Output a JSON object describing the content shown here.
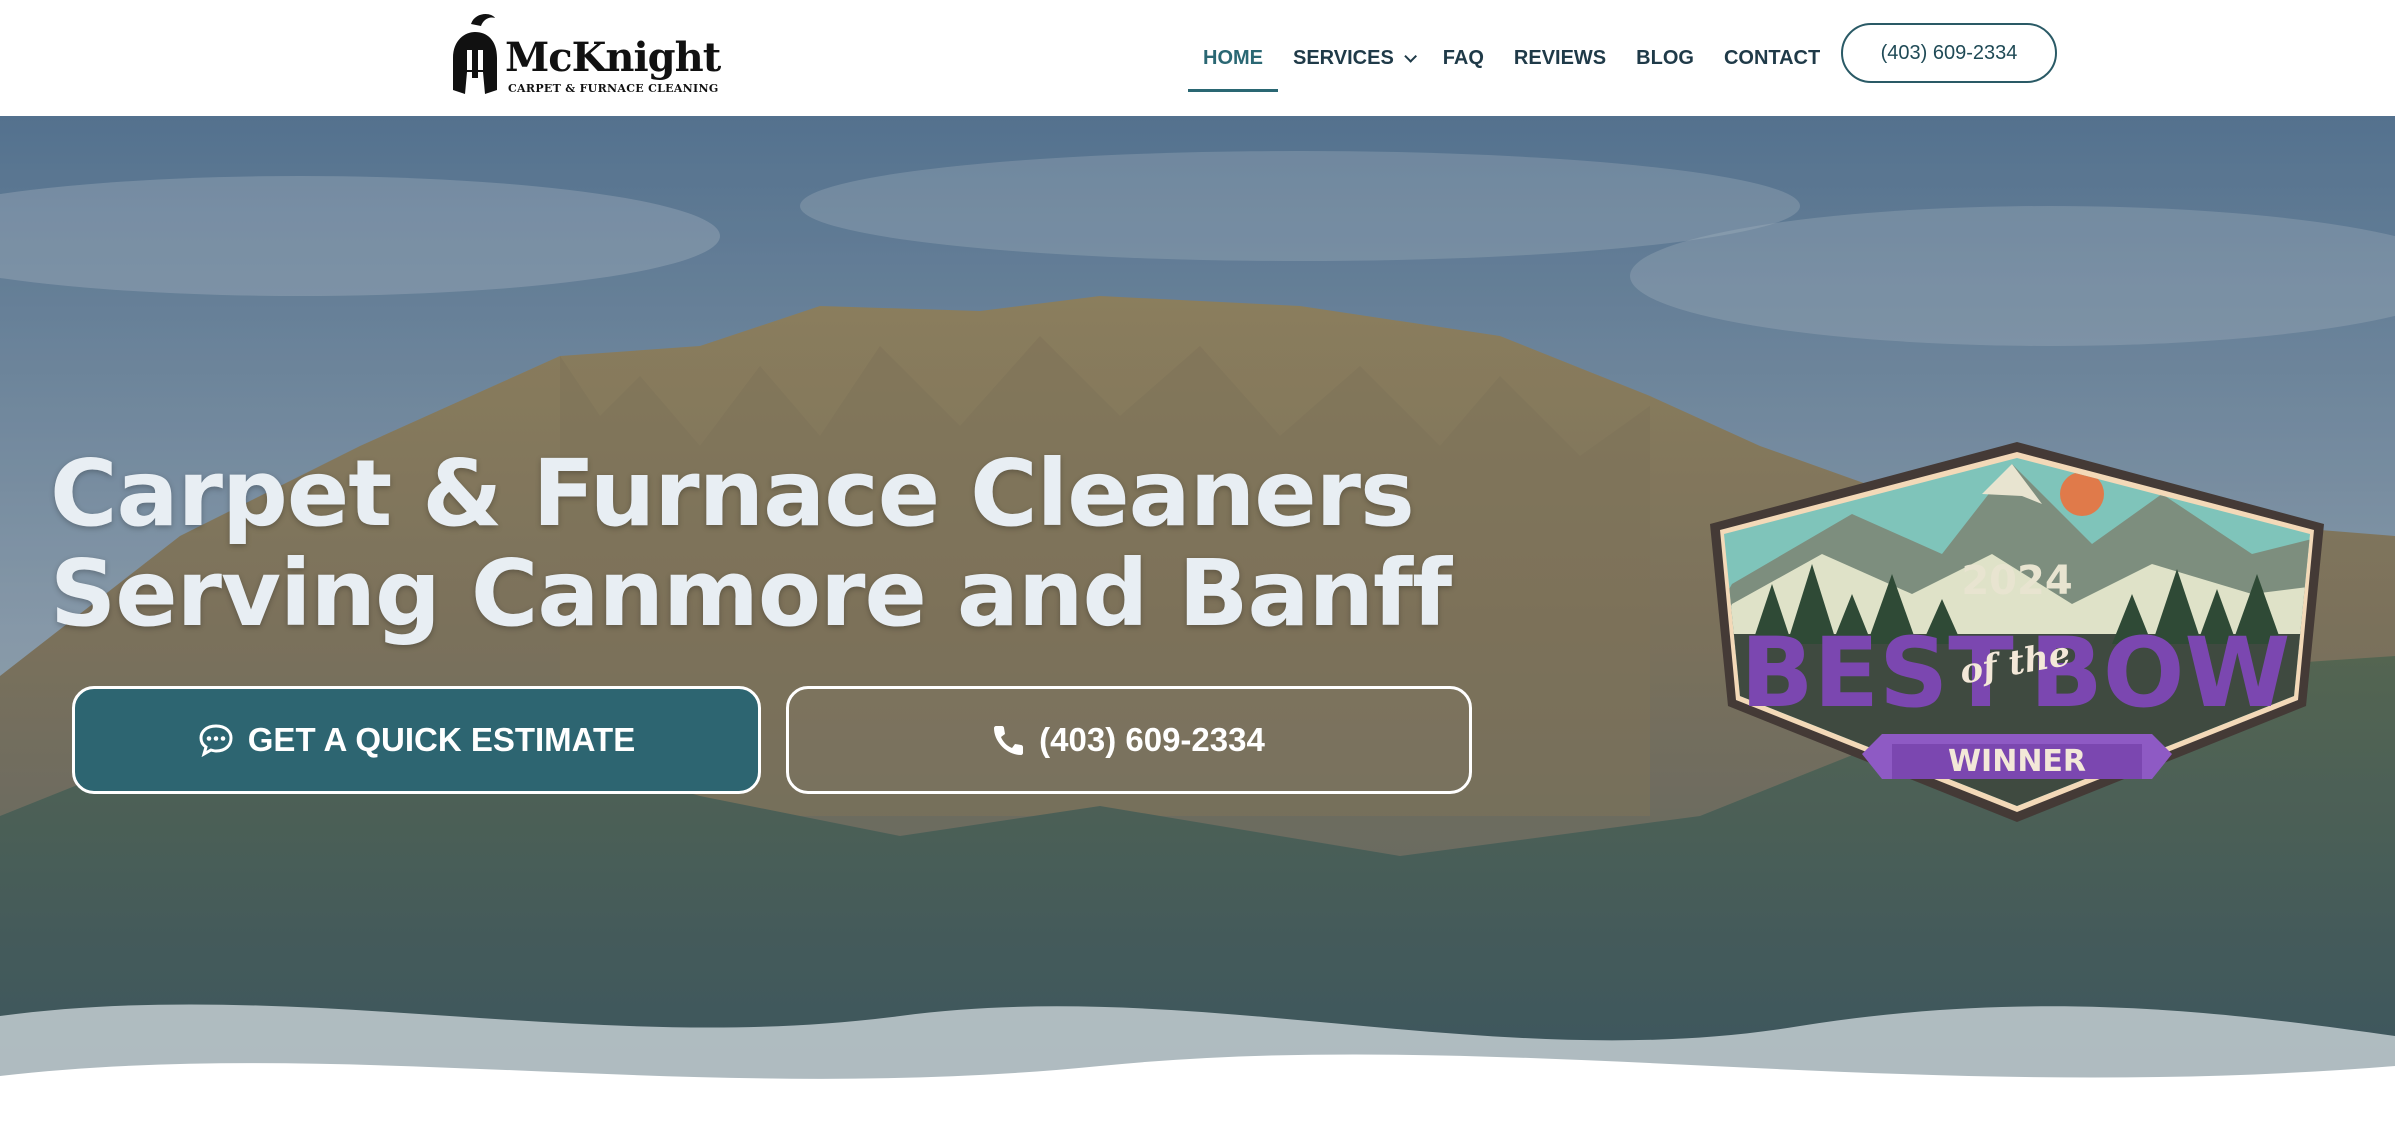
{
  "logo": {
    "title": "McKnight",
    "subtitle": "CARPET & FURNACE CLEANING"
  },
  "nav": {
    "items": [
      {
        "label": "HOME",
        "active": true
      },
      {
        "label": "SERVICES",
        "has_dropdown": true
      },
      {
        "label": "FAQ"
      },
      {
        "label": "REVIEWS"
      },
      {
        "label": "BLOG"
      },
      {
        "label": "CONTACT"
      }
    ],
    "phone_button": "(403) 609-2334"
  },
  "hero": {
    "headline_line1": "Carpet & Furnace Cleaners",
    "headline_line2": "Serving Canmore and Banff",
    "cta_estimate": "GET A QUICK ESTIMATE",
    "cta_phone": "(403) 609-2334",
    "estimate_icon": "chat-bubble-icon",
    "phone_icon": "phone-icon"
  },
  "badge": {
    "year": "2024",
    "text_left": "BEST",
    "text_middle": "of the",
    "text_right": "BOW",
    "ribbon": "WINNER"
  },
  "colors": {
    "brand_teal": "#2d6571",
    "nav_text": "#1f3a48",
    "badge_purple": "#7b47b0"
  }
}
